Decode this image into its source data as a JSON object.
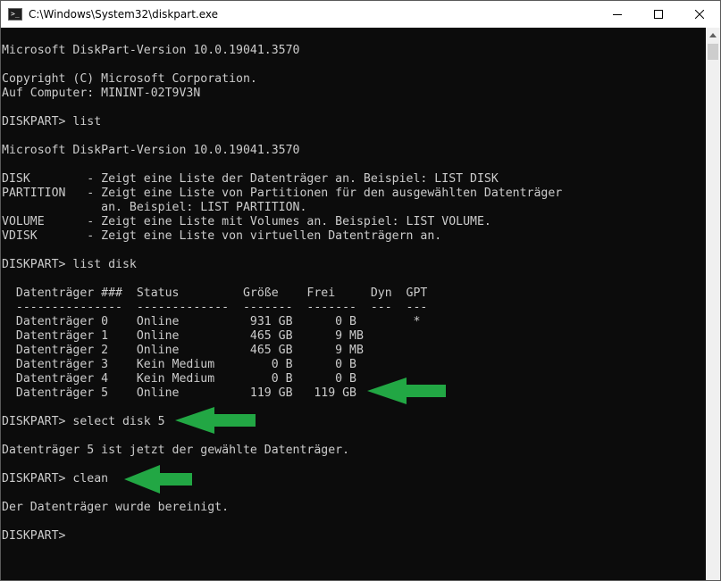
{
  "window": {
    "title": "C:\\Windows\\System32\\diskpart.exe",
    "icon": "console-app-icon",
    "controls": {
      "minimize": "minimize-icon",
      "maximize": "maximize-icon",
      "close": "close-icon"
    }
  },
  "colors": {
    "console_bg": "#0c0c0c",
    "console_text": "#cccccc",
    "annotation_arrow": "#22a744"
  },
  "console": {
    "lines": [
      "Microsoft DiskPart-Version 10.0.19041.3570",
      "",
      "Copyright (C) Microsoft Corporation.",
      "Auf Computer: MININT-02T9V3N",
      "",
      "DISKPART> list",
      "",
      "Microsoft DiskPart-Version 10.0.19041.3570",
      "",
      "DISK        - Zeigt eine Liste der Datenträger an. Beispiel: LIST DISK",
      "PARTITION   - Zeigt eine Liste von Partitionen für den ausgewählten Datenträger",
      "              an. Beispiel: LIST PARTITION.",
      "VOLUME      - Zeigt eine Liste mit Volumes an. Beispiel: LIST VOLUME.",
      "VDISK       - Zeigt eine Liste von virtuellen Datenträgern an.",
      "",
      "DISKPART> list disk",
      "",
      "  Datenträger ###  Status         Größe    Frei     Dyn  GPT",
      "  ---------------  -------------  -------  -------  ---  ---",
      "  Datenträger 0    Online          931 GB      0 B        *",
      "  Datenträger 1    Online          465 GB      9 MB",
      "  Datenträger 2    Online          465 GB      9 MB",
      "  Datenträger 3    Kein Medium        0 B      0 B",
      "  Datenträger 4    Kein Medium        0 B      0 B",
      "  Datenträger 5    Online          119 GB   119 GB",
      "",
      "DISKPART> select disk 5",
      "",
      "Datenträger 5 ist jetzt der gewählte Datenträger.",
      "",
      "DISKPART> clean",
      "",
      "Der Datenträger wurde bereinigt.",
      "",
      "DISKPART>"
    ]
  },
  "annotations": [
    {
      "name": "arrow-disk-5-row",
      "icon": "left-arrow-icon"
    },
    {
      "name": "arrow-select-disk-command",
      "icon": "left-arrow-icon"
    },
    {
      "name": "arrow-clean-command",
      "icon": "left-arrow-icon"
    }
  ],
  "scrollbar": {
    "up_icon": "scroll-up-arrow-icon"
  }
}
